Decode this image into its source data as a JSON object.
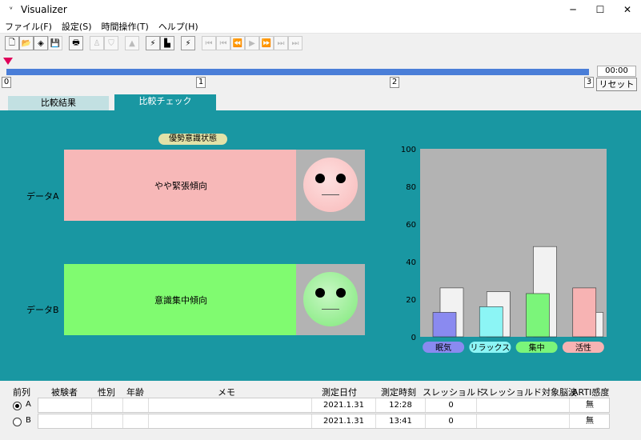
{
  "window": {
    "title": "Visualizer",
    "controls": [
      "─",
      "☐",
      "✕"
    ]
  },
  "menu": [
    "ファイル(F)",
    "設定(S)",
    "時間操作(T)",
    "ヘルプ(H)"
  ],
  "toolbar": {
    "icons": [
      "new-file-icon",
      "open-folder-icon",
      "layers-icon",
      "save-icon",
      "print-icon",
      "person-icon",
      "shield-icon",
      "triangle-icon",
      "lightning-icon",
      "bar-chart-icon",
      "plug-icon",
      "first-icon",
      "prev-end-icon",
      "rewind-icon",
      "play-icon",
      "forward-icon",
      "next-end-icon",
      "last-icon"
    ],
    "glyphs": [
      "🗋",
      "📂",
      "◈",
      "💾",
      "🖶",
      "♙",
      "⛉",
      "▲",
      "⚡",
      "▙",
      "⚡",
      "⏮",
      "⏮",
      "⏪",
      "▶",
      "⏩",
      "⏭",
      "⏭"
    ]
  },
  "timeline": {
    "ticks": [
      "0",
      "1",
      "2",
      "3"
    ],
    "time": "00:00",
    "reset_label": "リセット"
  },
  "tabs": [
    "比較結果",
    "比較チェック"
  ],
  "panel": {
    "badge": "優勢意識状態",
    "rows": [
      {
        "label": "データA",
        "result": "やや緊張傾向",
        "color": "#f7b8b8",
        "face_color": "#f9b9b9"
      },
      {
        "label": "データB",
        "result": "意識集中傾向",
        "color": "#80fb70",
        "face_color": "#7fe97a"
      }
    ]
  },
  "chart_data": {
    "type": "bar",
    "categories": [
      "眠気",
      "リラックス",
      "集中",
      "活性"
    ],
    "category_colors": [
      "#8a8af0",
      "#8cf5f5",
      "#7bf57a",
      "#f7b3b3"
    ],
    "series": [
      {
        "values": [
          13,
          16,
          23,
          26
        ],
        "colors": [
          "#8a8af0",
          "#8cf5f5",
          "#7bf57a",
          "#f7b3b3"
        ]
      },
      {
        "values": [
          26,
          24,
          48,
          13
        ],
        "colors": [
          "#f2f2f2",
          "#f2f2f2",
          "#f2f2f2",
          "#f2f2f2"
        ]
      }
    ],
    "ylim": [
      0,
      100
    ],
    "yticks": [
      0,
      20,
      40,
      60,
      80,
      100
    ]
  },
  "table": {
    "headers": [
      "前列",
      "被験者",
      "性別",
      "年齢",
      "メモ",
      "測定日付",
      "測定時刻",
      "スレッショルド",
      "スレッショルド対象脳波",
      "ARTI感度"
    ],
    "rows": [
      {
        "selected": true,
        "label": "A",
        "subject": "",
        "sex": "",
        "age": "",
        "memo": "",
        "date": "2021.1.31",
        "time": "12:28",
        "threshold": "0",
        "target": "",
        "arti": "無"
      },
      {
        "selected": false,
        "label": "B",
        "subject": "",
        "sex": "",
        "age": "",
        "memo": "",
        "date": "2021.1.31",
        "time": "13:41",
        "threshold": "0",
        "target": "",
        "arti": "無"
      }
    ]
  }
}
